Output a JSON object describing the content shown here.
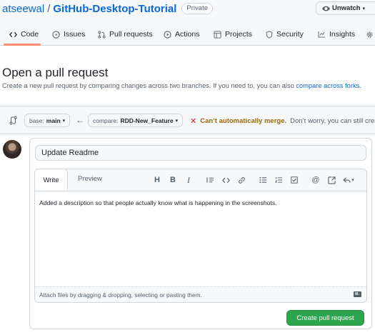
{
  "repo": {
    "owner": "atseewal",
    "separator": "/",
    "name": "GitHub-Desktop-Tutorial",
    "visibility": "Private",
    "unwatch_label": "Unwatch"
  },
  "tabs": [
    {
      "label": "Code",
      "icon": "code-icon",
      "selected": true
    },
    {
      "label": "Issues",
      "icon": "issue-icon"
    },
    {
      "label": "Pull requests",
      "icon": "pull-request-icon"
    },
    {
      "label": "Actions",
      "icon": "play-icon"
    },
    {
      "label": "Projects",
      "icon": "table-icon"
    },
    {
      "label": "Security",
      "icon": "shield-icon"
    },
    {
      "label": "Insights",
      "icon": "graph-icon"
    }
  ],
  "page": {
    "title": "Open a pull request",
    "subtitle_text": "Create a new pull request by comparing changes across two branches. If you need to, you can also ",
    "subtitle_link": "compare across forks."
  },
  "compare": {
    "base_prefix": "base:",
    "base_branch": "main",
    "compare_prefix": "compare:",
    "compare_branch": "RDD-New_Feature",
    "status_strong": "Can’t automatically merge.",
    "status_rest": "Don’t worry, you can still crea"
  },
  "form": {
    "title_value": "Update Readme",
    "write_tab": "Write",
    "preview_tab": "Preview",
    "body_value": "Added a description so that people actually know what is happening in the screenshots.",
    "attach_hint": "Attach files by dragging & dropping, selecting or pasting them.",
    "submit_label": "Create pull request"
  },
  "toolbar_icons": [
    "heading-icon",
    "bold-icon",
    "italic-icon",
    "quote-icon",
    "code-icon",
    "link-icon",
    "unordered-list-icon",
    "ordered-list-icon",
    "tasklist-icon",
    "mention-icon",
    "cross-reference-icon",
    "reply-icon"
  ],
  "colors": {
    "accent": "#0969da",
    "primary_button": "#2da44e",
    "tab_underline": "#fd8c73",
    "merge_warning": "#9a6700",
    "error_x": "#cf222e"
  }
}
